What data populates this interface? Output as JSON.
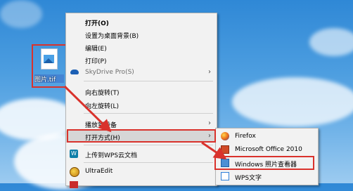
{
  "desktop": {
    "file_label": "图片.tif"
  },
  "context_menu": {
    "items": [
      {
        "label": "打开(O)",
        "bold": true
      },
      {
        "label": "设置为桌面背景(B)"
      },
      {
        "label": "编辑(E)"
      },
      {
        "label": "打印(P)"
      },
      {
        "label": "SkyDrive Pro(S)",
        "disabled": true,
        "icon": "cloud-icon",
        "submenu": true
      },
      {
        "label": "向右旋转(T)"
      },
      {
        "label": "向左旋转(L)"
      },
      {
        "label": "播放到设备",
        "submenu": true
      },
      {
        "label": "打开方式(H)",
        "submenu": true
      },
      {
        "label": "上传到WPS云文档",
        "icon": "wps-cloud-icon"
      },
      {
        "label": "UltraEdit",
        "icon": "ultraedit-icon"
      },
      {
        "label": "",
        "icon": "app-icon"
      }
    ]
  },
  "open_with_submenu": {
    "items": [
      {
        "label": "Firefox",
        "icon": "firefox-icon"
      },
      {
        "label": "Microsoft Office 2010",
        "icon": "office-picture-manager-icon"
      },
      {
        "label": "Windows 照片查看器",
        "icon": "windows-photo-viewer-icon",
        "selected": true
      },
      {
        "label": "WPS文字",
        "icon": "wps-writer-icon"
      }
    ]
  },
  "annotation_color": "#d9322c"
}
